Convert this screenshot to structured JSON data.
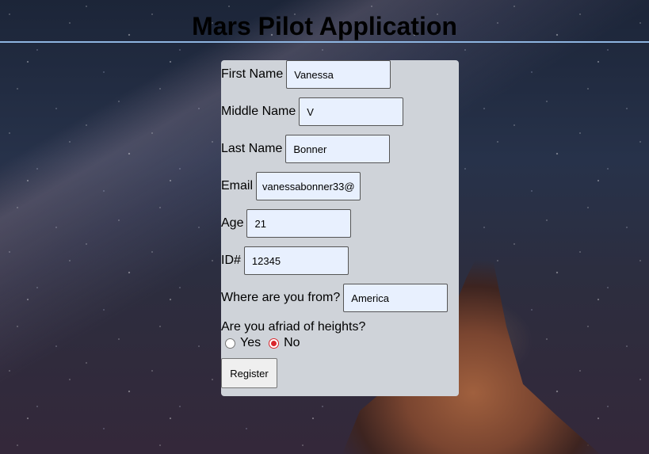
{
  "page": {
    "title": "Mars Pilot Application"
  },
  "form": {
    "first_name": {
      "label": "First Name",
      "value": "Vanessa"
    },
    "middle_name": {
      "label": "Middle Name",
      "value": "V"
    },
    "last_name": {
      "label": "Last Name",
      "value": "Bonner"
    },
    "email": {
      "label": "Email",
      "value": "vanessabonner33@"
    },
    "age": {
      "label": "Age",
      "value": "21"
    },
    "id": {
      "label": "ID#",
      "value": "12345"
    },
    "origin": {
      "label": "Where are you from?",
      "value": "America"
    },
    "heights_question": "Are you afriad of heights?",
    "heights_options": [
      {
        "label": "Yes",
        "checked": false
      },
      {
        "label": "No",
        "checked": true
      }
    ],
    "register_label": "Register"
  },
  "colors": {
    "card_bg": "#cfd3d9",
    "input_bg": "#e8f0fe",
    "radio_checked": "#d9262c",
    "header_line": "#8db4e0"
  }
}
